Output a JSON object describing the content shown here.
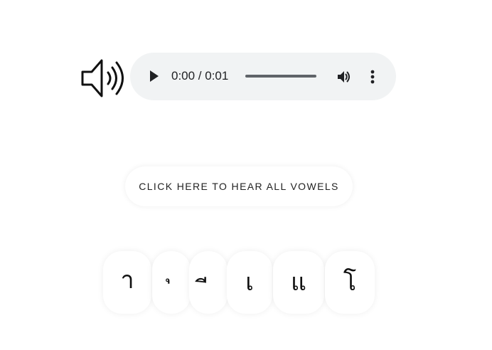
{
  "audio": {
    "time": "0:00 / 0:01",
    "progress": 0
  },
  "icons": {
    "speaker": "speaker-icon",
    "play": "play-icon",
    "volume": "volume-icon",
    "menu": "more-vert-icon"
  },
  "hear_all_label": "CLICK HERE TO HEAR ALL VOWELS",
  "vowels": [
    "า",
    "ุ",
    "ี",
    "เ",
    "แ",
    "โ"
  ],
  "colors": {
    "player_bg": "#f1f3f4",
    "text": "#202124"
  }
}
